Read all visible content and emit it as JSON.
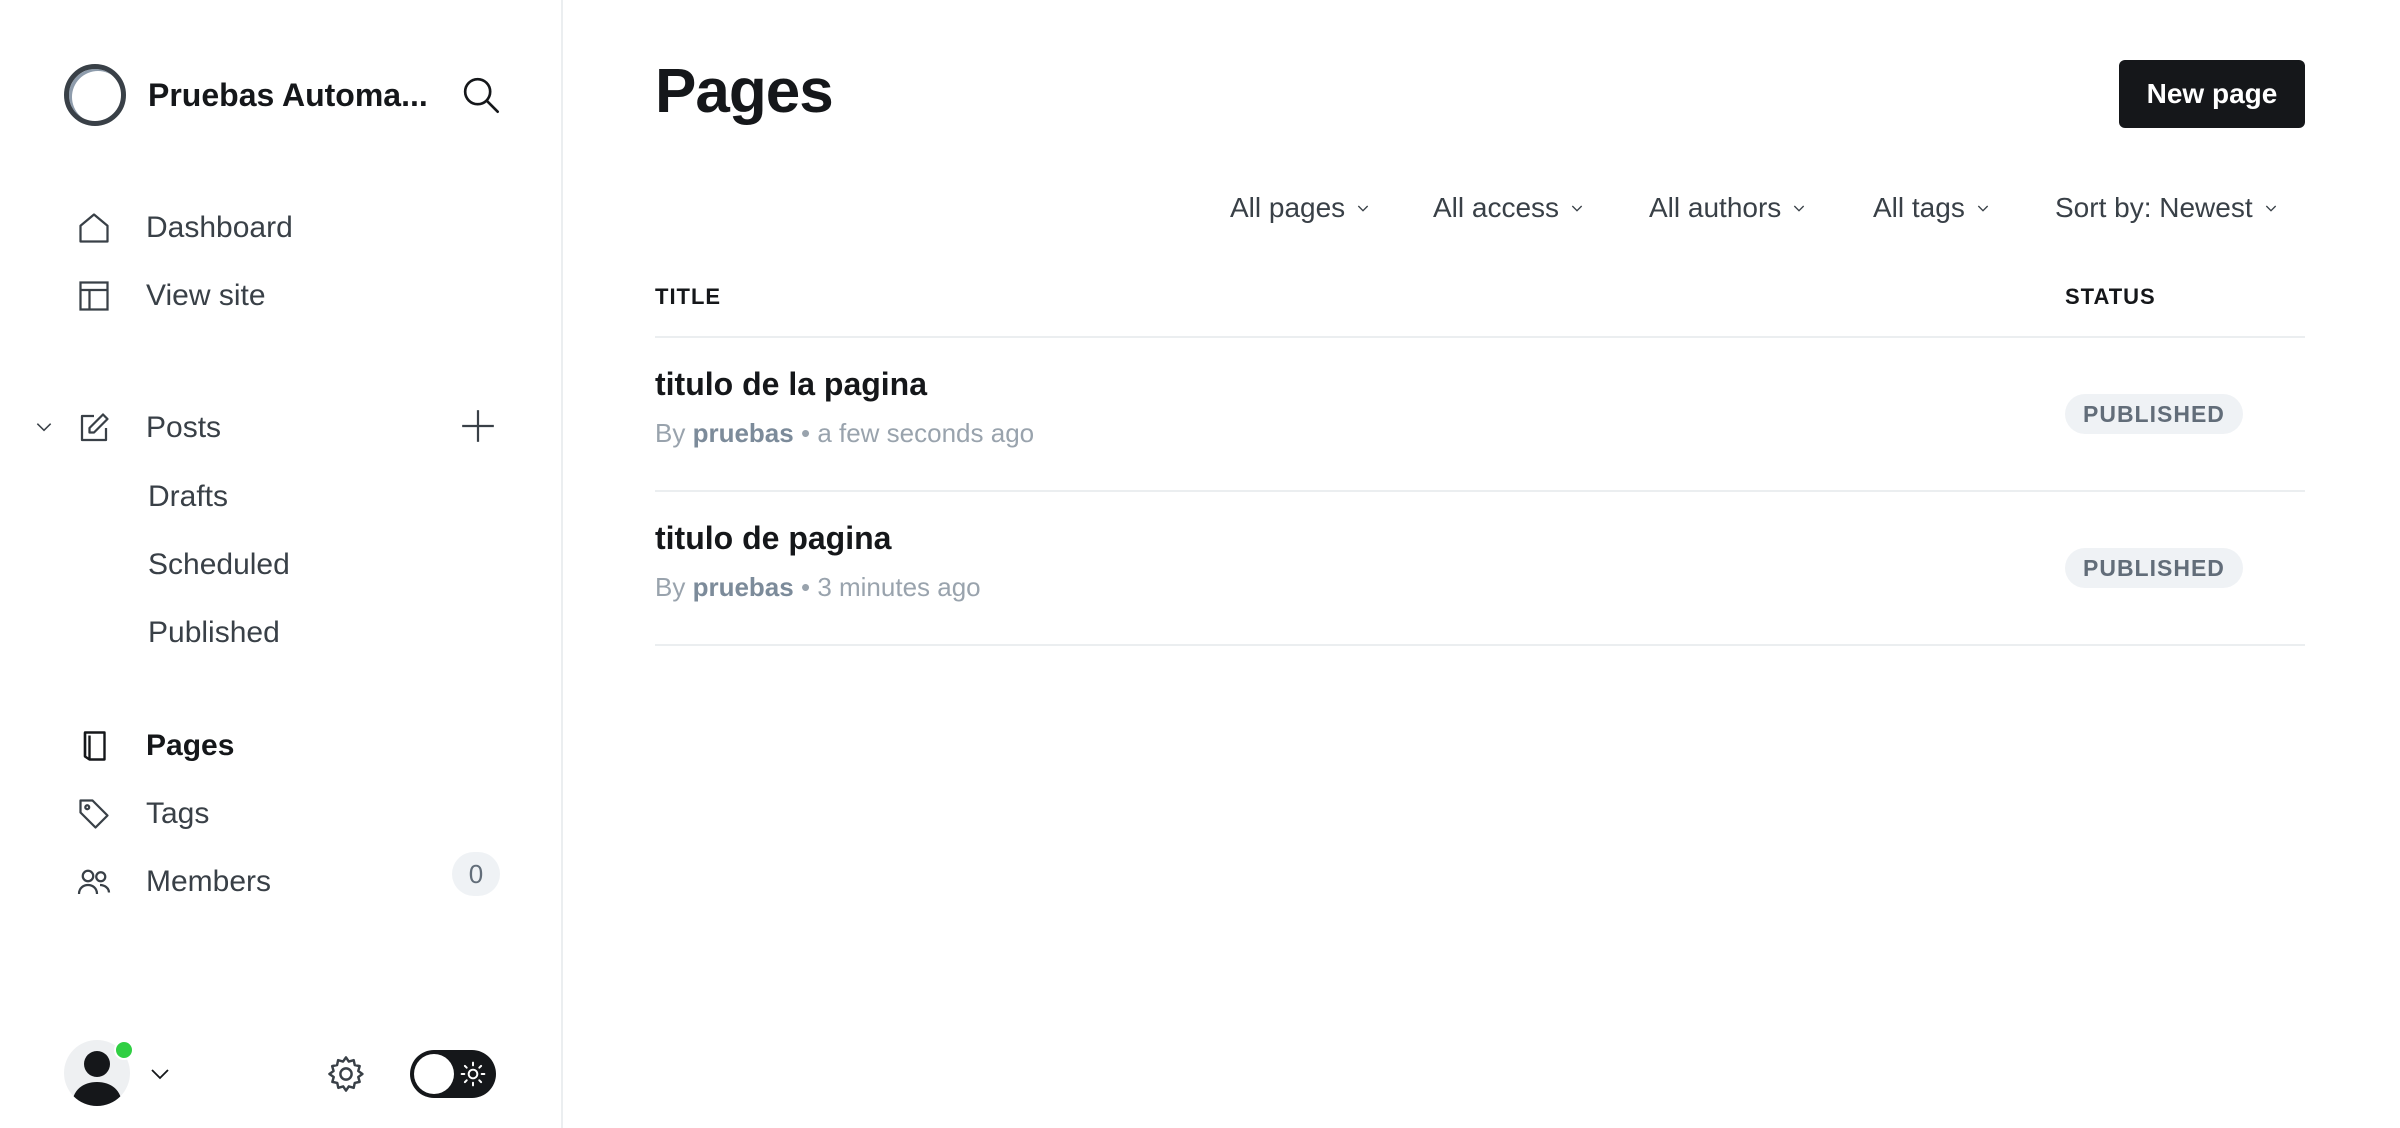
{
  "sidebar": {
    "brand_name": "Pruebas Automa...",
    "nav": {
      "dashboard": "Dashboard",
      "view_site": "View site",
      "posts": "Posts",
      "pages": "Pages",
      "tags": "Tags",
      "members": "Members",
      "members_count": "0"
    },
    "posts_sub": {
      "drafts": "Drafts",
      "scheduled": "Scheduled",
      "published": "Published"
    },
    "user_online_color": "#30cf43"
  },
  "main": {
    "title": "Pages",
    "new_button": "New page",
    "filters": {
      "type": "All pages",
      "access": "All access",
      "authors": "All authors",
      "tags": "All tags",
      "sort": "Sort by: Newest"
    },
    "columns": {
      "title": "TITLE",
      "status": "STATUS"
    },
    "rows": [
      {
        "title": "titulo de la pagina",
        "by": "By",
        "author": "pruebas",
        "sep": "•",
        "time": "a few seconds ago",
        "status": "PUBLISHED"
      },
      {
        "title": "titulo de pagina",
        "by": "By",
        "author": "pruebas",
        "sep": "•",
        "time": "3 minutes ago",
        "status": "PUBLISHED"
      }
    ]
  },
  "colors": {
    "primary": "#15171a",
    "muted": "#99a3ad",
    "divider": "#ebeef0"
  }
}
